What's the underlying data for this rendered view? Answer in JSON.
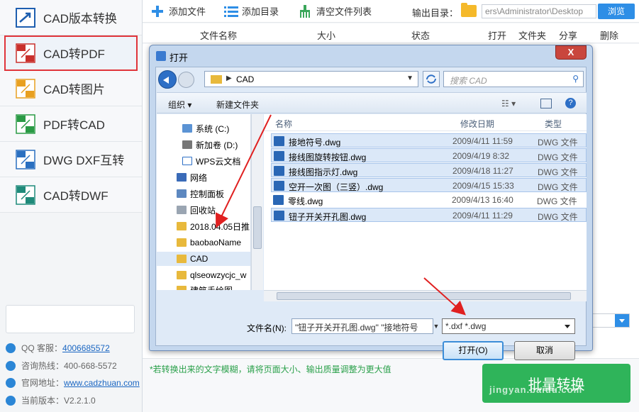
{
  "sidebar": {
    "items": [
      {
        "label": "CAD版本转换",
        "icon": "cad-version-icon"
      },
      {
        "label": "CAD转PDF",
        "icon": "cad-to-pdf-icon"
      },
      {
        "label": "CAD转图片",
        "icon": "cad-to-image-icon"
      },
      {
        "label": "PDF转CAD",
        "icon": "pdf-to-cad-icon"
      },
      {
        "label": "DWG DXF互转",
        "icon": "dwg-dxf-icon"
      },
      {
        "label": "CAD转DWF",
        "icon": "cad-to-dwf-icon"
      }
    ],
    "qq_label": "QQ 客服：",
    "qq_number": "4006685572",
    "hotline": "咨询热线：400-668-5572",
    "site_label": "官网地址：",
    "site_url": "www.cadzhuan.com",
    "version": "当前版本：V2.2.1.0"
  },
  "toolbar": {
    "add_file": "添加文件",
    "add_dir": "添加目录",
    "clear_list": "清空文件列表",
    "output_label": "输出目录：",
    "output_path": "ers\\Administrator\\Desktop",
    "browse": "浏览"
  },
  "columns": {
    "name": "文件名称",
    "size": "大小",
    "status": "状态",
    "open": "打开",
    "folder": "文件夹",
    "share": "分享",
    "delete": "删除"
  },
  "hint": "*若转换出来的文字模糊，请将页面大小、输出质量调整为更大值",
  "batch_convert": "批量转换",
  "watermark": "jingyan.baidu.com",
  "dialog": {
    "title": "打开",
    "close": "X",
    "address": "CAD",
    "search_placeholder": "搜索 CAD",
    "organize": "组织 ▾",
    "new_folder": "新建文件夹",
    "tree": [
      {
        "label": "系统 (C:)"
      },
      {
        "label": "新加卷 (D:)"
      },
      {
        "label": "WPS云文档"
      },
      {
        "label": "网络"
      },
      {
        "label": "控制面板"
      },
      {
        "label": "回收站"
      },
      {
        "label": "2018.04.05日推"
      },
      {
        "label": "baobaoName"
      },
      {
        "label": "CAD"
      },
      {
        "label": "qlseowzycjc_w"
      },
      {
        "label": "建筑手绘图"
      }
    ],
    "file_headers": {
      "name": "名称",
      "date": "修改日期",
      "type": "类型"
    },
    "files": [
      {
        "name": "接地符号.dwg",
        "date": "2009/4/11 11:59",
        "type": "DWG 文件"
      },
      {
        "name": "接线图旋转按钮.dwg",
        "date": "2009/4/19 8:32",
        "type": "DWG 文件"
      },
      {
        "name": "接线图指示灯.dwg",
        "date": "2009/4/18 11:27",
        "type": "DWG 文件"
      },
      {
        "name": "空开一次图（三竖）.dwg",
        "date": "2009/4/15 15:33",
        "type": "DWG 文件"
      },
      {
        "name": "零线.dwg",
        "date": "2009/4/13 16:40",
        "type": "DWG 文件"
      },
      {
        "name": "钮子开关开孔图.dwg",
        "date": "2009/4/11 11:29",
        "type": "DWG 文件"
      }
    ],
    "filename_label": "文件名(N):",
    "filename_value": "\"钮子开关开孔图.dwg\" \"接地符号",
    "filetype_value": "*.dxf *.dwg",
    "open_button": "打开(O)",
    "cancel_button": "取消"
  },
  "colors": {
    "accent": "#2e8ee6",
    "active_border": "#e0343a",
    "convert_green": "#2fb45a",
    "arrow_red": "#e02020"
  }
}
